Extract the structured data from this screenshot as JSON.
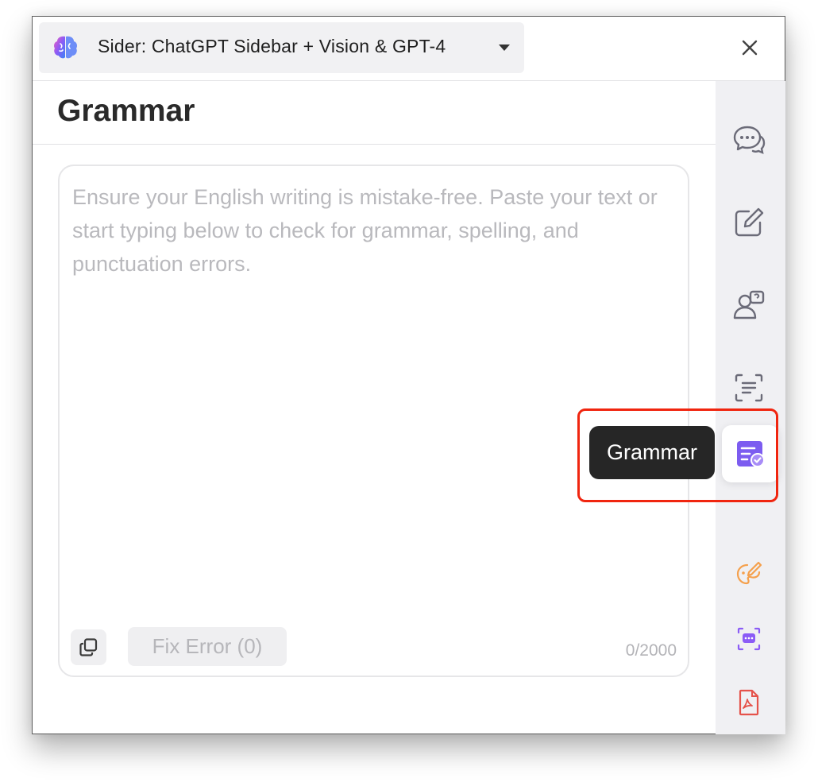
{
  "header": {
    "app_name": "Sider: ChatGPT Sidebar + Vision & GPT-4",
    "logo_icon": "sider-brain-logo",
    "dropdown_icon": "caret-down-icon",
    "close_icon": "close-icon"
  },
  "main": {
    "title": "Grammar",
    "editor": {
      "placeholder": "Ensure your English writing is mistake-free. Paste your text or start typing below to check for grammar, spelling, and punctuation errors.",
      "value": "",
      "char_count": "0/2000"
    },
    "fix_button_label": "Fix Error (0)",
    "copy_icon": "copy-icon"
  },
  "sidebar": {
    "items": [
      {
        "id": "chat",
        "icon": "chat-bubbles-icon"
      },
      {
        "id": "write",
        "icon": "edit-icon"
      },
      {
        "id": "ask",
        "icon": "person-question-icon"
      },
      {
        "id": "ocr",
        "icon": "scan-text-icon"
      },
      {
        "id": "grammar",
        "icon": "grammar-check-icon",
        "active": true
      },
      {
        "id": "art",
        "icon": "paint-brush-icon"
      },
      {
        "id": "scan-chat",
        "icon": "scan-chat-icon"
      },
      {
        "id": "pdf",
        "icon": "pdf-icon"
      }
    ],
    "tooltip": "Grammar"
  },
  "colors": {
    "accent": "#7c5cf0",
    "highlight": "#f0250f",
    "tooltip_bg": "#262626",
    "sidebar_bg": "#f0f0f3",
    "orange_icon": "#f5a04c",
    "red_icon": "#e5534b"
  }
}
